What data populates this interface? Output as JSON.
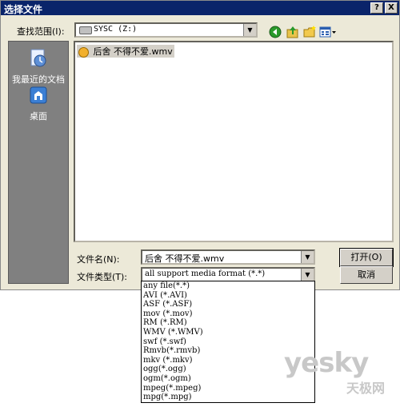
{
  "window": {
    "title": "选择文件",
    "help_btn": "?",
    "close_btn": "X"
  },
  "lookin": {
    "label": "查找范围(I):",
    "value": "SYSC (Z:)"
  },
  "places": [
    {
      "label": "我最近的文档",
      "icon": "recent-documents-icon"
    },
    {
      "label": "桌面",
      "icon": "desktop-icon"
    }
  ],
  "files": [
    {
      "name": "后舍 不得不爱.wmv",
      "icon": "media-file-icon"
    }
  ],
  "filename": {
    "label": "文件名(N):",
    "value": "后舍 不得不爱.wmv"
  },
  "filetype": {
    "label": "文件类型(T):",
    "value": "all support media format (*.*)"
  },
  "buttons": {
    "open": "打开(O)",
    "cancel": "取消"
  },
  "filetype_options": [
    "any file(*.*)",
    "AVI (*.AVI)",
    "ASF (*.ASF)",
    "mov (*.mov)",
    "RM (*.RM)",
    "WMV (*.WMV)",
    "swf (*.swf)",
    "Rmvb(*.rmvb)",
    "mkv (*.mkv)",
    "ogg(*.ogg)",
    "ogm(*.ogm)",
    "mpeg(*.mpeg)",
    "mpg(*.mpg)",
    "all support media format (*.*)"
  ],
  "selected_option_index": 13,
  "watermark": {
    "main": "yesky",
    "sub": "天极网"
  },
  "colors": {
    "titlebar": "#0a246a",
    "dialog_bg": "#ece9d8",
    "sidebar": "#808080",
    "selection": "#0a246a"
  }
}
